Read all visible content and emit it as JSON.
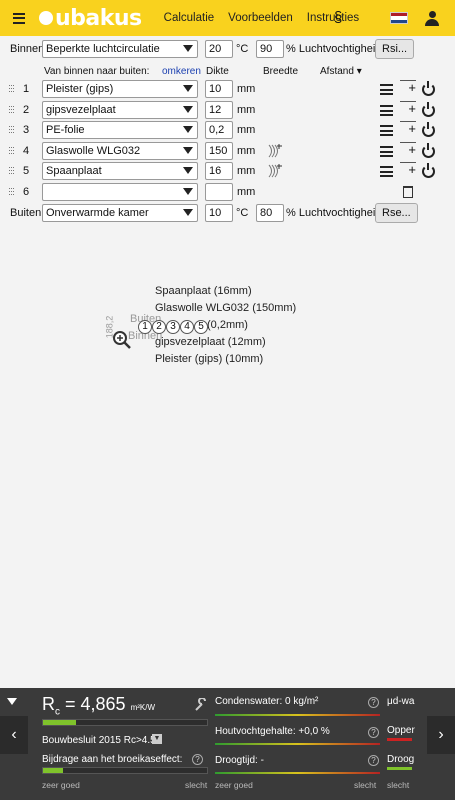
{
  "header": {
    "logo": "ubakus",
    "nav": [
      "Calculatie",
      "Voorbeelden",
      "Instructies"
    ],
    "paragraph_symbol": "§"
  },
  "inside": {
    "label": "Binnen:",
    "selected": "Beperkte luchtcirculatie",
    "temp": "20",
    "temp_unit": "°C",
    "humidity": "90",
    "humidity_label": "% Luchtvochtigheid",
    "button": "Rsi..."
  },
  "columns": {
    "order_label": "Van binnen naar buiten:",
    "reverse_link": "omkeren",
    "thickness": "Dikte",
    "width": "Breedte",
    "distance": "Afstand ▾"
  },
  "layers": [
    {
      "num": "1",
      "material": "Pleister (gips)",
      "thickness": "10",
      "unit": "mm"
    },
    {
      "num": "2",
      "material": "gipsvezelplaat",
      "thickness": "12",
      "unit": "mm"
    },
    {
      "num": "3",
      "material": "PE-folie",
      "thickness": "0,2",
      "unit": "mm"
    },
    {
      "num": "4",
      "material": "Glaswolle WLG032",
      "thickness": "150",
      "unit": "mm"
    },
    {
      "num": "5",
      "material": "Spaanplaat",
      "thickness": "16",
      "unit": "mm"
    },
    {
      "num": "6",
      "material": "",
      "thickness": "",
      "unit": "mm"
    }
  ],
  "outside": {
    "label": "Buiten:",
    "selected": "Onverwarmde kamer",
    "temp": "10",
    "temp_unit": "°C",
    "humidity": "80",
    "humidity_label": "% Luchtvochtigheid",
    "button": "Rse..."
  },
  "drawing": {
    "labels": [
      "Spaanplaat (16mm)",
      "Glaswolle WLG032 (150mm)",
      "(0,2mm)",
      "gipsvezelplaat (12mm)",
      "Pleister (gips) (10mm)"
    ],
    "buiten": "Buiten",
    "binnen": "Binnen",
    "dimension": "188,2",
    "circles": [
      "1",
      "2",
      "3",
      "4",
      "5"
    ]
  },
  "results": {
    "rc_label": "R",
    "rc_sub": "c",
    "rc_value": "= 4,865",
    "rc_unit": "m²K/W",
    "rc_bar_fraction": 0.2,
    "regulation": "Bouwbesluit 2015 Rc>4.5",
    "greenhouse_label": "Bijdrage aan het broeikaseffect:",
    "good": "zeer goed",
    "bad": "slecht",
    "condensate": "Condenswater: 0 kg/m²",
    "wood_moisture": "Houtvochtgehalte: +0,0 %",
    "drying_time": "Droogtijd: -",
    "right_col": [
      "μd-wa",
      "Opper",
      "Droog"
    ],
    "right_bad": "slecht"
  },
  "colors": {
    "header_bg": "#f9d21e",
    "panel_bg": "#3a3a3a",
    "good_green": "#7fc32b",
    "link_blue": "#1a3fb0"
  }
}
